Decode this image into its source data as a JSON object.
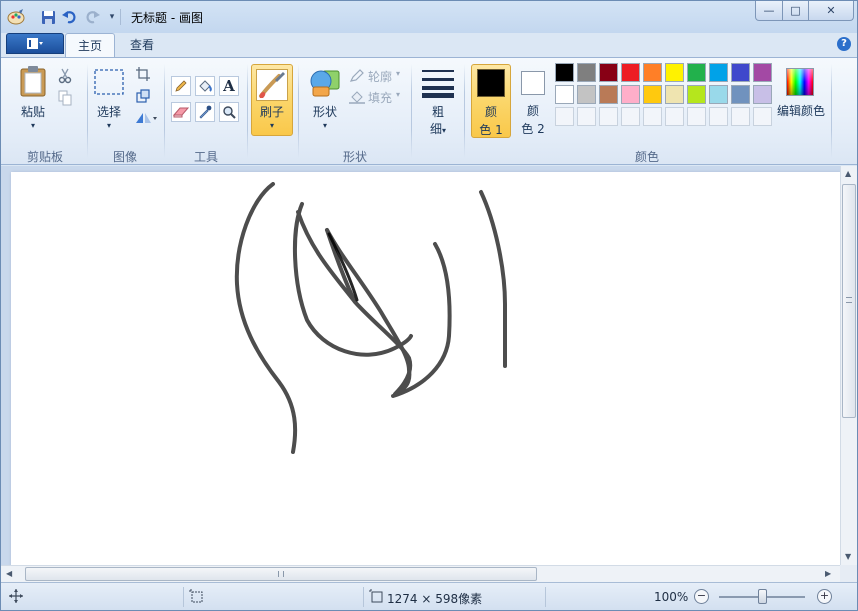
{
  "window": {
    "title": "无标题 - 画图",
    "controls": {
      "minimize": "—",
      "maximize": "□",
      "close": "✕"
    }
  },
  "tabs": [
    {
      "label": "主页",
      "active": true
    },
    {
      "label": "查看",
      "active": false
    }
  ],
  "groups": {
    "clipboard": {
      "label": "剪贴板",
      "paste_label": "粘贴"
    },
    "image": {
      "label": "图像",
      "select_label": "选择"
    },
    "tools": {
      "label": "工具"
    },
    "brush": {
      "label": "刷子"
    },
    "shapes": {
      "label": "形状",
      "shapes_label": "形状",
      "outline_label": "轮廓",
      "fill_label": "填充"
    },
    "size": {
      "label_line1": "粗",
      "label_line2": "细"
    },
    "colors": {
      "label": "颜色",
      "color1_line1": "颜",
      "color1_line2": "色 1",
      "color2_line1": "颜",
      "color2_line2": "色 2",
      "edit_label": "编辑颜色",
      "color1_value": "#000000",
      "color2_value": "#ffffff",
      "palette_row1": [
        "#000000",
        "#7f7f7f",
        "#880015",
        "#ed1c24",
        "#ff7f27",
        "#fff200",
        "#22b14c",
        "#00a2e8",
        "#3f48cc",
        "#a349a4"
      ],
      "palette_row2": [
        "#ffffff",
        "#c3c3c3",
        "#b97a57",
        "#ffaec9",
        "#ffc90e",
        "#efe4b0",
        "#b5e61d",
        "#99d9ea",
        "#7092be",
        "#c8bfe7"
      ]
    }
  },
  "statusbar": {
    "dimensions": "1274 × 598像素",
    "zoom": "100%",
    "zoom_fraction": 0.5
  }
}
